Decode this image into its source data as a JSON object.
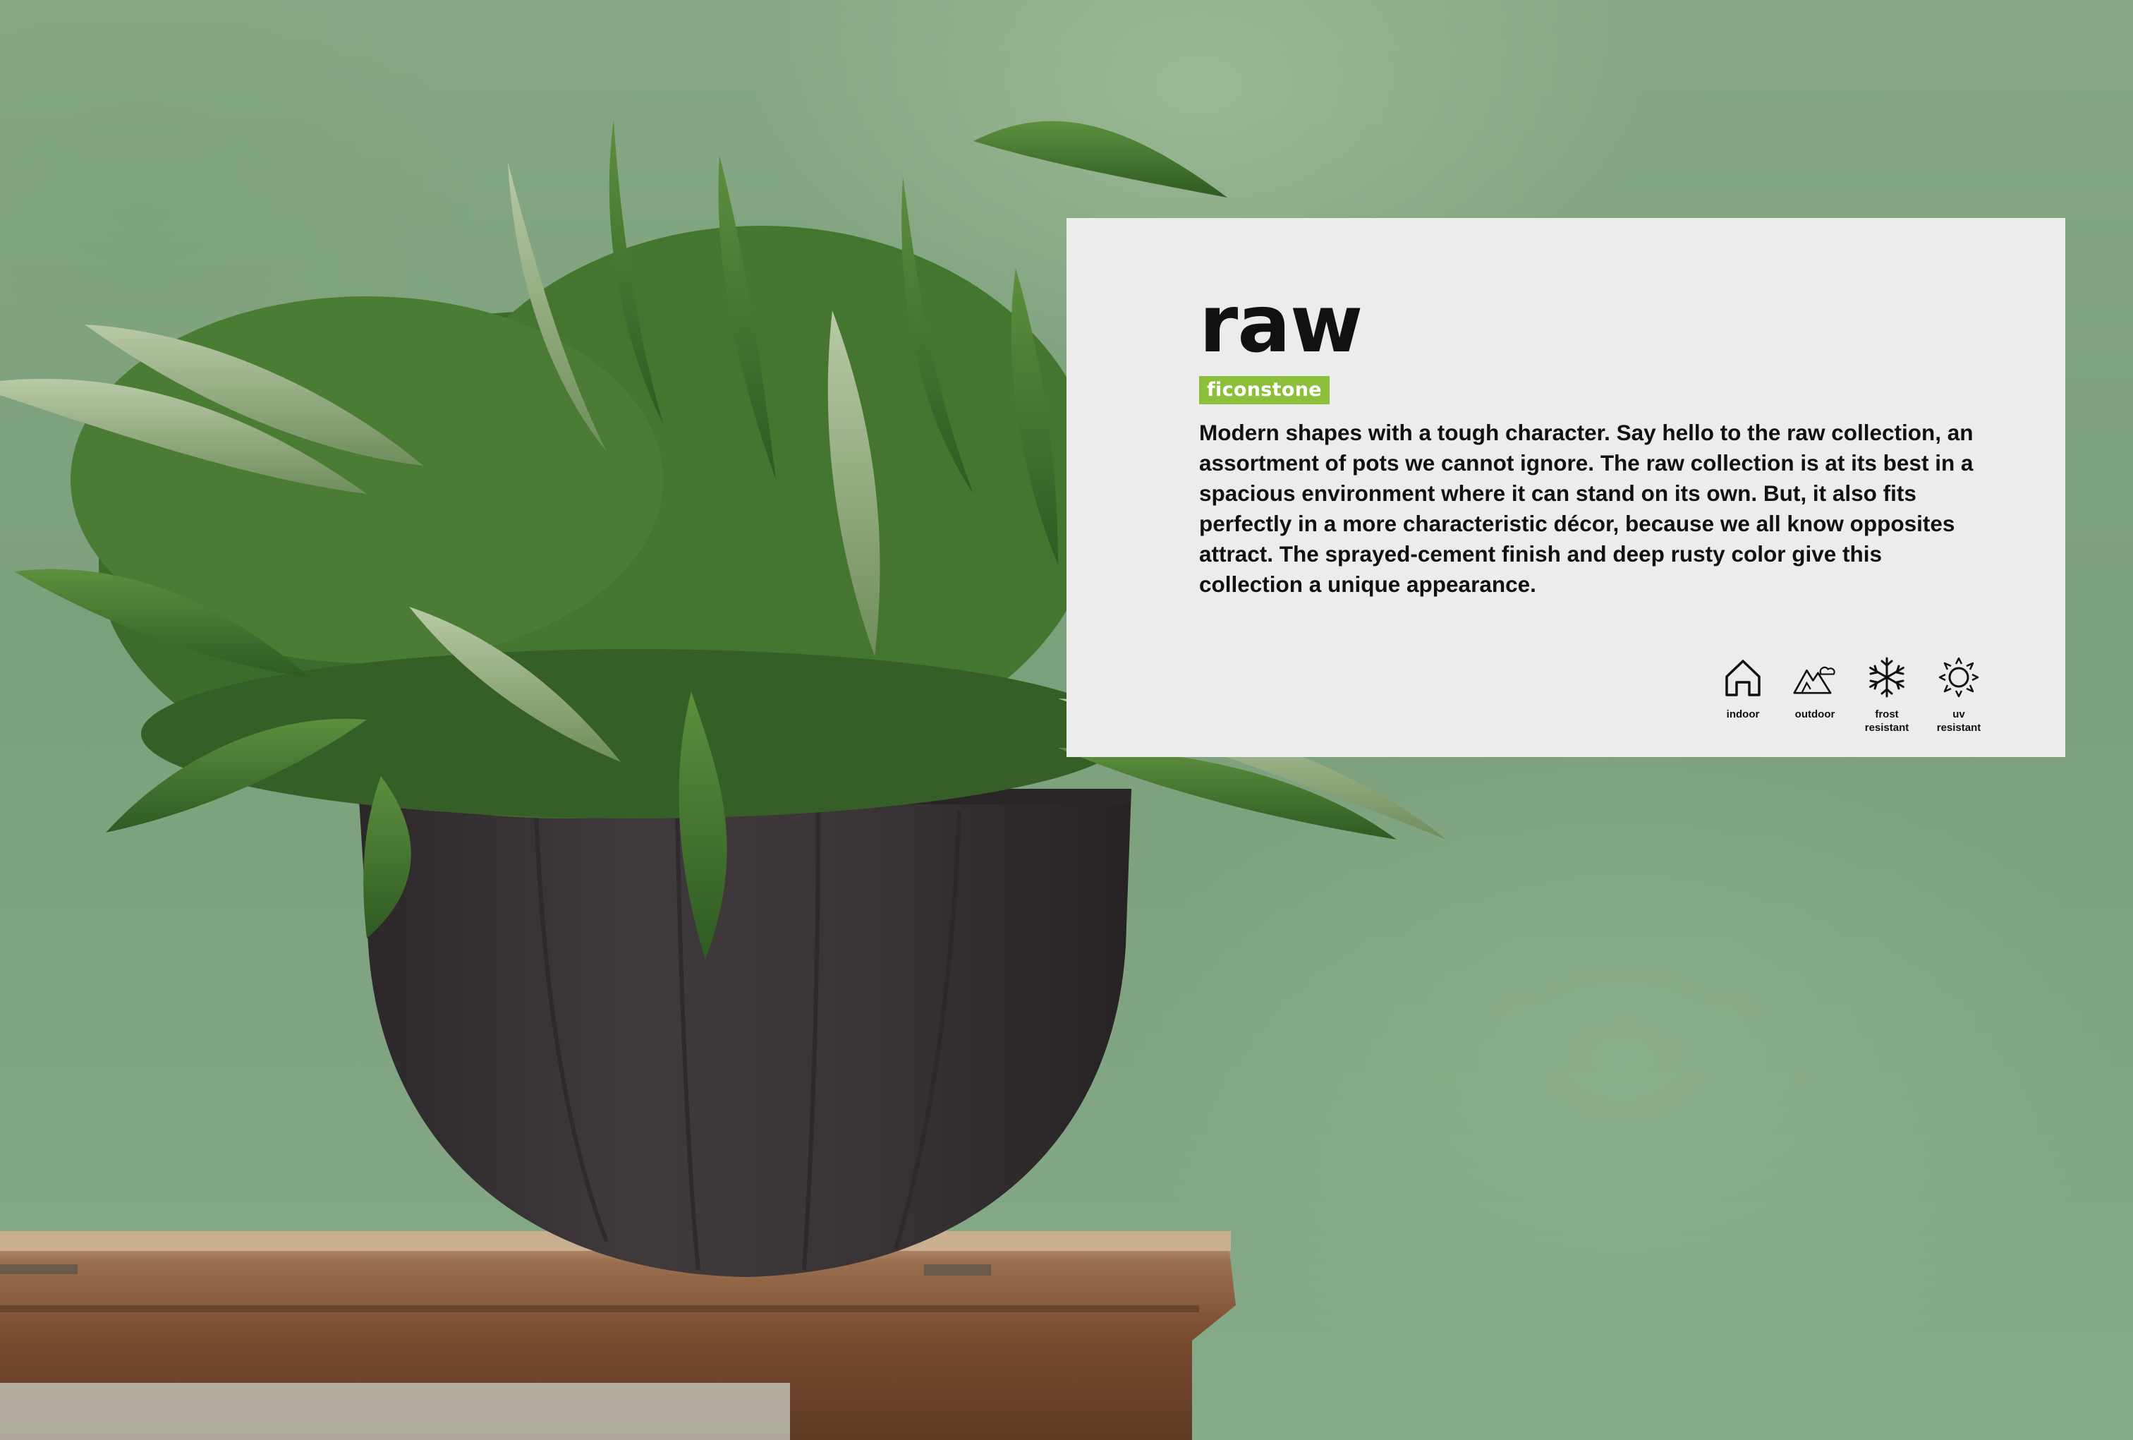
{
  "panel": {
    "title": "raw",
    "brand_badge": "ficonstone",
    "description": "Modern shapes with a tough character. Say hello to the raw collection, an assortment of pots we cannot ignore. The raw collection is at its best in a spacious environment where it can stand on its own. But, it also fits perfectly in a more characteristic décor, because we all know opposites attract. The sprayed-cement finish and deep rusty color give this collection a unique appearance.",
    "features": [
      {
        "icon": "house-icon",
        "label": "indoor"
      },
      {
        "icon": "mountain-cloud-icon",
        "label": "outdoor"
      },
      {
        "icon": "snowflake-icon",
        "label": "frost\nresistant"
      },
      {
        "icon": "sun-icon",
        "label": "uv\nresistant"
      }
    ]
  },
  "colors": {
    "badge": "#8cbf3a",
    "panel": "#ececec",
    "wall": "#7ea27e",
    "pot": "#3a3538"
  }
}
